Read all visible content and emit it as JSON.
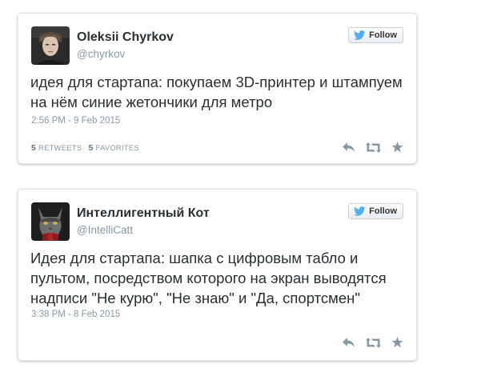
{
  "colors": {
    "card_border": "#e1e8ed",
    "text": "#292f33",
    "muted": "#8899a6",
    "action_icon": "#8899a6",
    "twitter_blue": "#55acee"
  },
  "tweets": [
    {
      "author_name": "Oleksii Chyrkov",
      "author_handle": "@chyrkov",
      "follow_label": "Follow",
      "text": "идея для стартапа: покупаем 3D-принтер и штампуем на нём синие жетончики для метро",
      "timestamp": "2:56 PM - 9 Feb 2015",
      "retweets_count": "5",
      "retweets_label": "RETWEETS",
      "favorites_count": "5",
      "favorites_label": "FAVORITES",
      "icons": [
        "avatar-photo",
        "twitter-bird-icon",
        "reply-icon",
        "retweet-icon",
        "favorite-star-icon"
      ]
    },
    {
      "author_name": "Интеллигентный Кот",
      "author_handle": "@IntelliCatt",
      "follow_label": "Follow",
      "text": "Идея для стартапа: шапка с цифровым табло и пультом, посредством которого на экран выводятся надписи \"Не курю\", \"Не знаю\" и \"Да, спортсмен\"",
      "timestamp": "3:38 PM - 8 Feb 2015",
      "icons": [
        "avatar-photo",
        "twitter-bird-icon",
        "reply-icon",
        "retweet-icon",
        "favorite-star-icon"
      ]
    }
  ]
}
